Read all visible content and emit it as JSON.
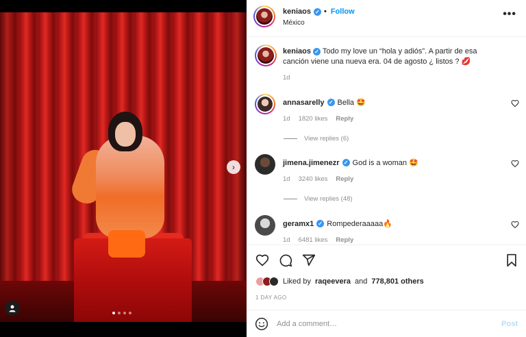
{
  "header": {
    "username": "keniaos",
    "follow_label": "Follow",
    "separator": "•",
    "location": "México",
    "more_label": "•••"
  },
  "caption": {
    "username": "keniaos",
    "text": "Todo my love un “hola y adiós”. A partir de esa canción viene una nueva era. 04 de agosto ¿ listos ? 💋",
    "time": "1d"
  },
  "comments": [
    {
      "username": "annasarelly",
      "text": "Bella 🤩",
      "time": "1d",
      "likes": "1820 likes",
      "reply_label": "Reply",
      "view_replies": "View replies (6)"
    },
    {
      "username": "jimena.jimenezr",
      "text": "God is a woman 🤩",
      "time": "1d",
      "likes": "3240 likes",
      "reply_label": "Reply",
      "view_replies": "View replies (48)"
    },
    {
      "username": "geramx1",
      "text": "Rompederaaaaa🔥",
      "time": "1d",
      "likes": "6481 likes",
      "reply_label": "Reply"
    }
  ],
  "likes": {
    "liked_by_prefix": "Liked by",
    "liked_by_user": "raqeevera",
    "and_label": "and",
    "count": "778,801 others"
  },
  "date": "1 DAY AGO",
  "add_comment": {
    "emoji_icon": "smiley-icon",
    "placeholder": "Add a comment…",
    "post_label": "Post"
  },
  "carousel": {
    "slides": 4,
    "active_index": 0
  },
  "colors": {
    "link": "#0095f6",
    "verified": "#3897f0",
    "muted": "#8e8e8e",
    "post_disabled": "#b2dffc"
  }
}
